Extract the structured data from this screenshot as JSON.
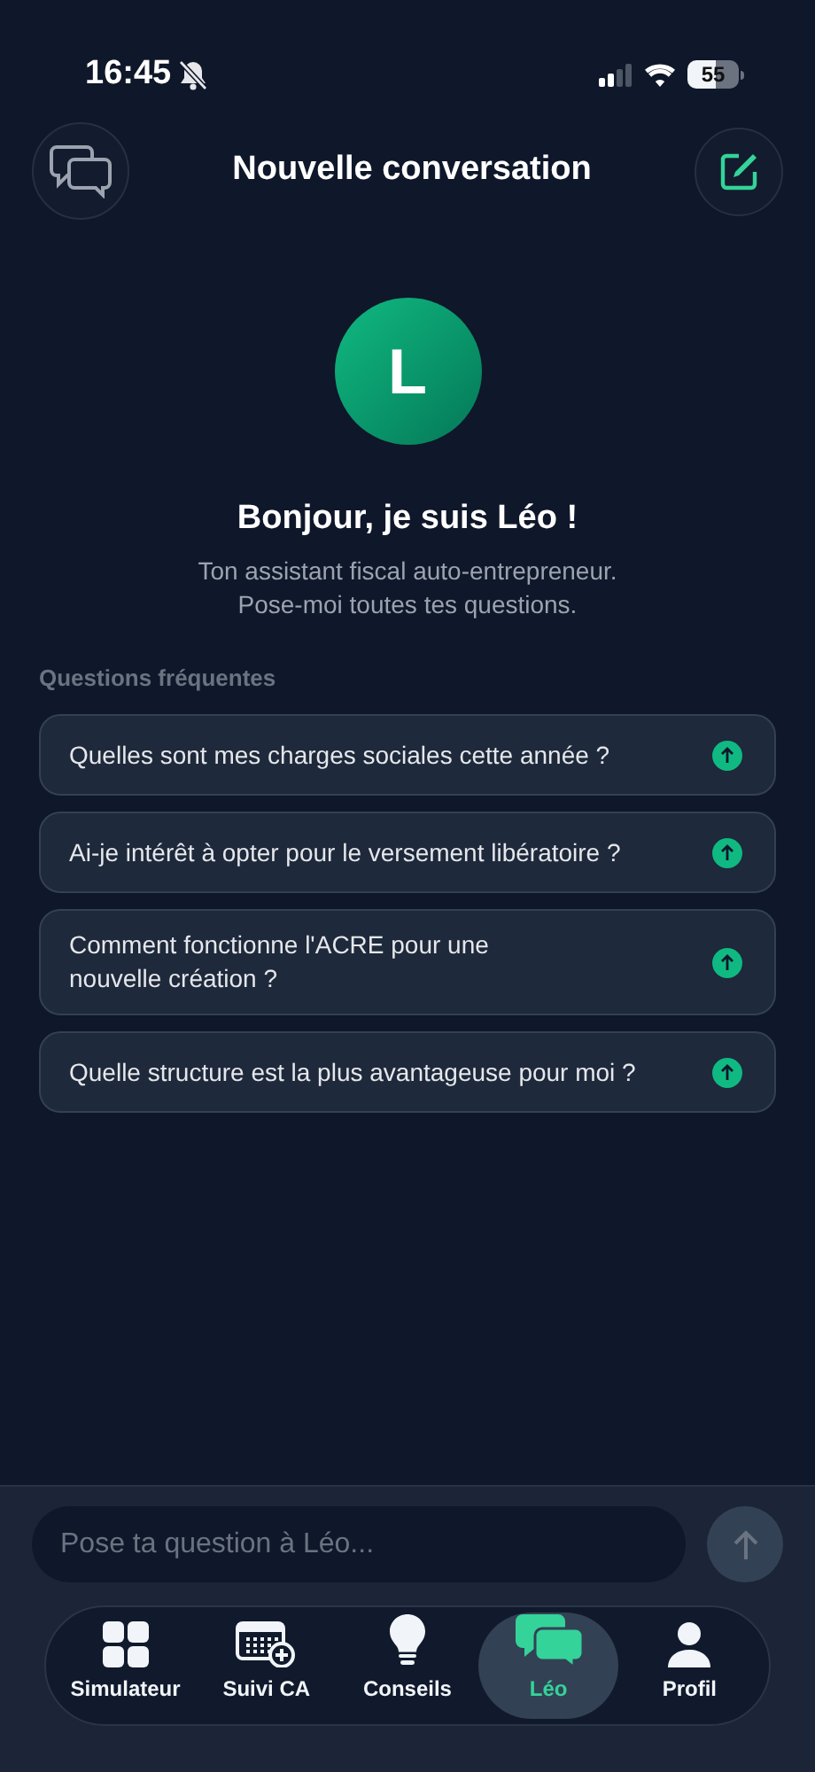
{
  "status_bar": {
    "time": "16:45",
    "battery": "55"
  },
  "header": {
    "title": "Nouvelle conversation"
  },
  "assistant": {
    "initial": "L",
    "greeting": "Bonjour, je suis Léo !",
    "subtitle": "Ton assistant fiscal auto-entrepreneur.\nPose-moi toutes tes questions."
  },
  "faq": {
    "heading": "Questions fréquentes",
    "questions": [
      {
        "text": "Quelles sont mes charges sociales cette année ?"
      },
      {
        "text": "Ai-je intérêt à opter pour le versement libératoire ?"
      },
      {
        "text": "Comment fonctionne l'ACRE pour une\nnouvelle création ?"
      },
      {
        "text": "Quelle structure est la plus avantageuse pour moi ?"
      }
    ]
  },
  "composer": {
    "placeholder": "Pose ta question à Léo..."
  },
  "tabs": [
    {
      "kind": "grid",
      "label": "Simulateur",
      "selected": false
    },
    {
      "kind": "calendar",
      "label": "Suivi CA",
      "selected": false
    },
    {
      "kind": "bulb",
      "label": "Conseils",
      "selected": false
    },
    {
      "kind": "chat",
      "label": "Léo",
      "selected": true
    },
    {
      "kind": "person",
      "label": "Profil",
      "selected": false
    }
  ]
}
